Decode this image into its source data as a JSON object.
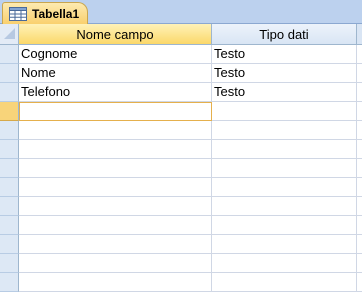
{
  "tab": {
    "label": "Tabella1",
    "icon": "table-icon"
  },
  "columns": {
    "field_name": "Nome campo",
    "data_type": "Tipo dati"
  },
  "rows": [
    {
      "field_name": "Cognome",
      "data_type": "Testo"
    },
    {
      "field_name": "Nome",
      "data_type": "Testo"
    },
    {
      "field_name": "Telefono",
      "data_type": "Testo"
    },
    {
      "field_name": "",
      "data_type": ""
    },
    {
      "field_name": "",
      "data_type": ""
    },
    {
      "field_name": "",
      "data_type": ""
    },
    {
      "field_name": "",
      "data_type": ""
    },
    {
      "field_name": "",
      "data_type": ""
    },
    {
      "field_name": "",
      "data_type": ""
    },
    {
      "field_name": "",
      "data_type": ""
    },
    {
      "field_name": "",
      "data_type": ""
    },
    {
      "field_name": "",
      "data_type": ""
    },
    {
      "field_name": "",
      "data_type": ""
    }
  ],
  "current_row": 3,
  "colors": {
    "accent": "#f9cf6b",
    "header": "#d9e5f4",
    "grid": "#d0d7e5"
  }
}
